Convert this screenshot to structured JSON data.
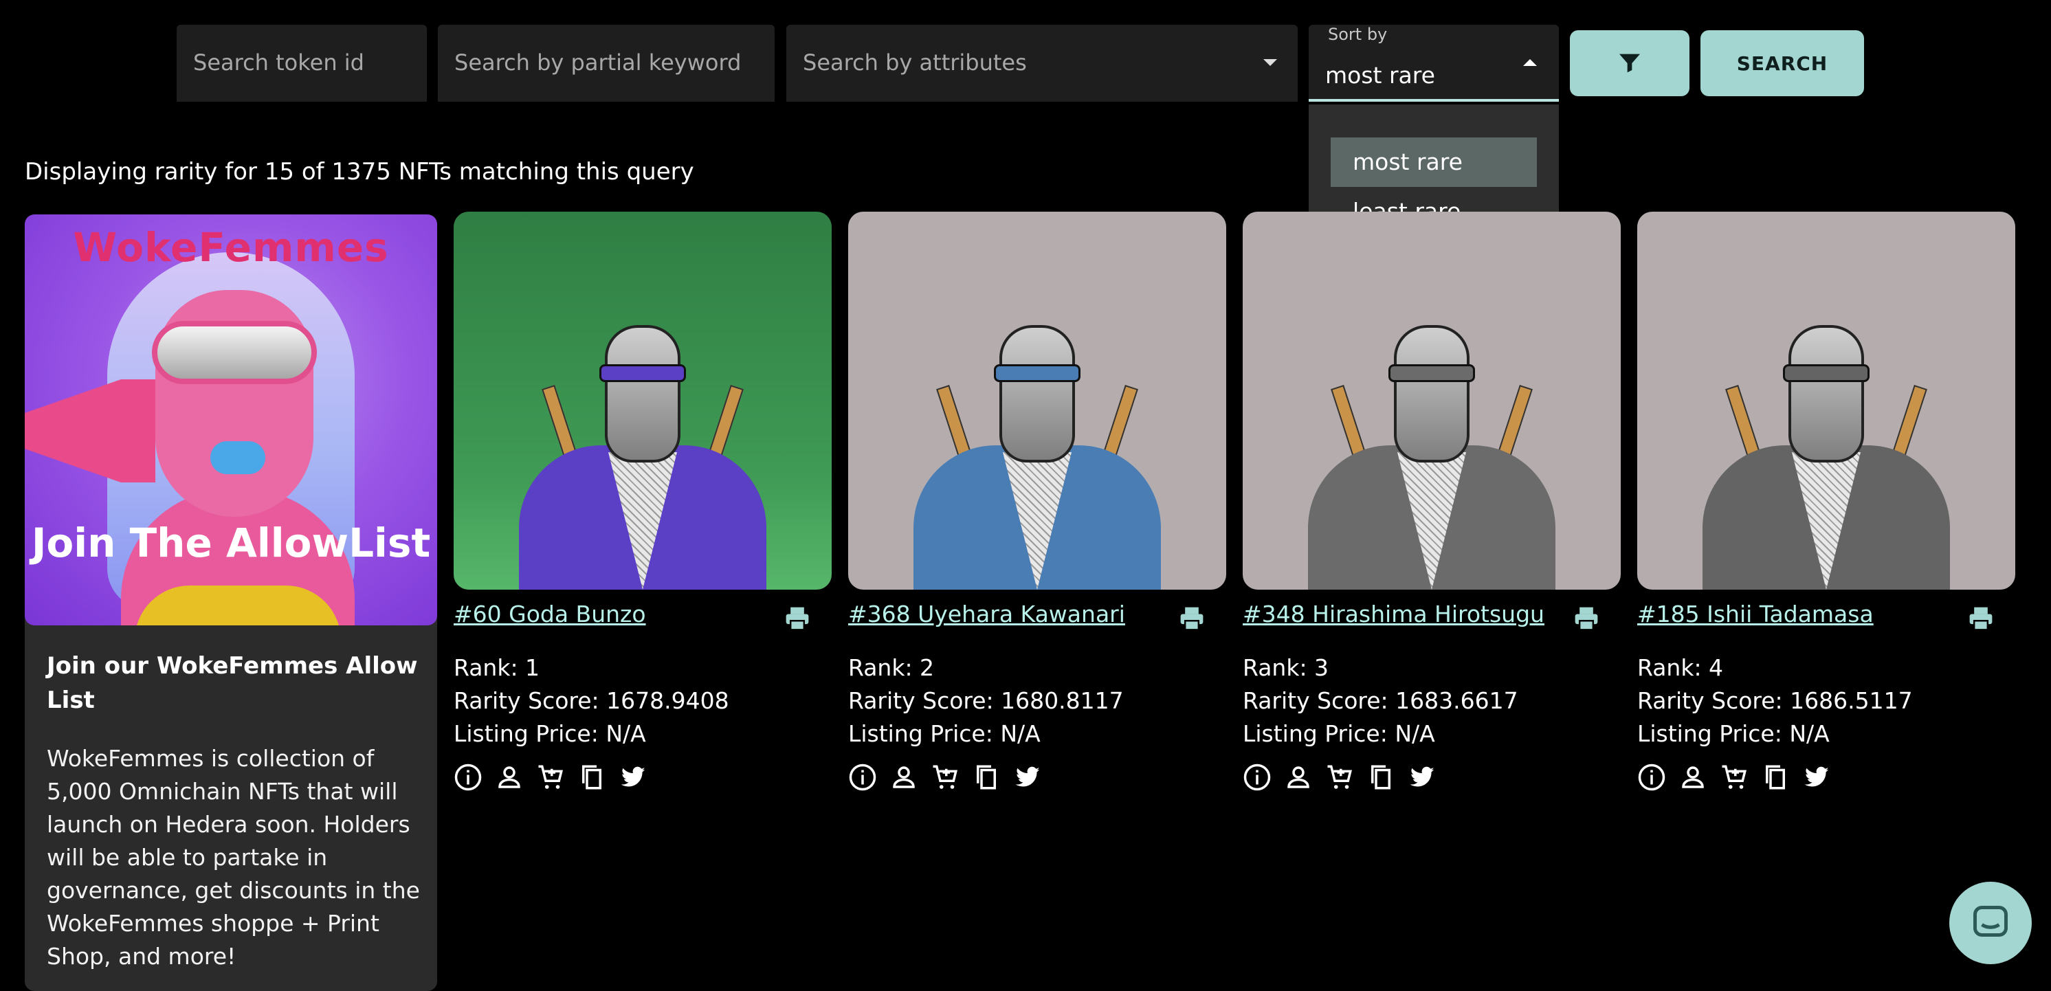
{
  "search": {
    "token_placeholder": "Search token id",
    "keyword_placeholder": "Search by partial keyword",
    "attributes_placeholder": "Search by attributes",
    "sort_label": "Sort by",
    "sort_value": "most rare",
    "sort_options": [
      "most rare",
      "least rare"
    ],
    "search_button": "SEARCH",
    "filter_icon": "filter-icon"
  },
  "summary": "Displaying rarity for 15 of 1375 NFTs matching this query",
  "promo": {
    "art_title": "WokeFemmes",
    "art_caption": "Join The AllowList",
    "title": "Join our WokeFemmes Allow List",
    "body": "WokeFemmes is collection of 5,000 Omnichain NFTs that will launch on Hedera soon. Holders will be able to partake in governance, get discounts in the WokeFemmes shoppe + Print Shop, and more!"
  },
  "cards": [
    {
      "name": "#60 Goda Bunzo",
      "rank": "Rank: 1",
      "score": "Rarity Score: 1678.9408",
      "price": "Listing Price: N/A",
      "bg": "green",
      "robe": "#5b3fc4"
    },
    {
      "name": "#368 Uyehara Kawanari",
      "rank": "Rank: 2",
      "score": "Rarity Score: 1680.8117",
      "price": "Listing Price: N/A",
      "bg": "grey",
      "robe": "#4a7db4"
    },
    {
      "name": "#348 Hirashima Hirotsugu",
      "rank": "Rank: 3",
      "score": "Rarity Score: 1683.6617",
      "price": "Listing Price: N/A",
      "bg": "grey",
      "robe": "#6b6b6b"
    },
    {
      "name": "#185 Ishii Tadamasa",
      "rank": "Rank: 4",
      "score": "Rarity Score: 1686.5117",
      "price": "Listing Price: N/A",
      "bg": "grey",
      "robe": "#646464"
    }
  ],
  "card_icons": [
    "info-icon",
    "person-icon",
    "cart-icon",
    "copy-icon",
    "twitter-icon"
  ],
  "colors": {
    "accent": "#a3d6d1",
    "link": "#b8f0ea",
    "background": "#000000",
    "panel": "#1e1e1e"
  }
}
